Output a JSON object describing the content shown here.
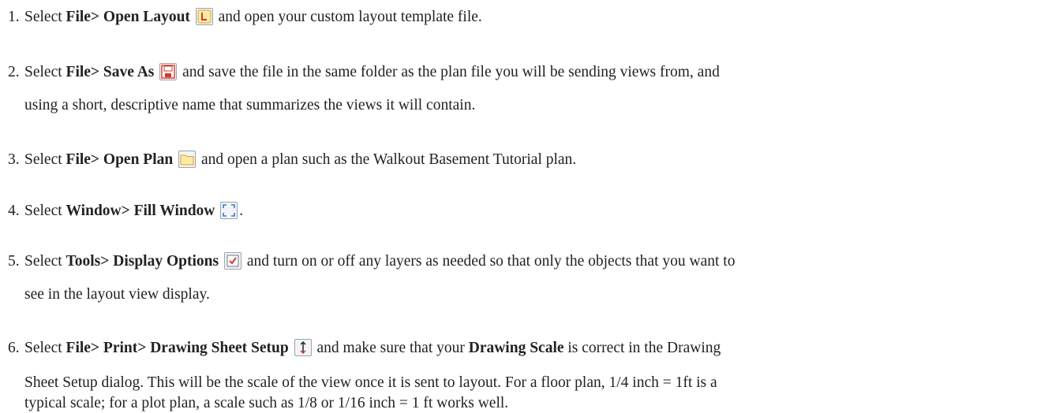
{
  "steps": [
    {
      "number": "1.",
      "lines": [
        [
          {
            "t": "Select "
          },
          {
            "t": "File> Open Layout",
            "b": true
          },
          {
            "t": " "
          },
          {
            "icon": "open-layout-icon"
          },
          {
            "t": " and open your custom layout template file."
          }
        ]
      ]
    },
    {
      "number": "2.",
      "lines": [
        [
          {
            "t": "Select "
          },
          {
            "t": "File> Save As",
            "b": true
          },
          {
            "t": " "
          },
          {
            "icon": "save-as-icon"
          },
          {
            "t": " and save the file in the same folder as the plan file you will be sending views from, and"
          }
        ],
        [
          {
            "t": "using a short, descriptive name that summarizes the views it will contain."
          }
        ]
      ]
    },
    {
      "number": "3.",
      "lines": [
        [
          {
            "t": "Select "
          },
          {
            "t": "File> Open Plan",
            "b": true
          },
          {
            "t": " "
          },
          {
            "icon": "open-plan-icon"
          },
          {
            "t": " and open a plan such as the Walkout Basement Tutorial plan."
          }
        ]
      ]
    },
    {
      "number": "4.",
      "lines": [
        [
          {
            "t": "Select "
          },
          {
            "t": "Window> Fill Window",
            "b": true
          },
          {
            "t": " "
          },
          {
            "icon": "fill-window-icon"
          },
          {
            "t": "."
          }
        ]
      ]
    },
    {
      "number": "5.",
      "lines": [
        [
          {
            "t": "Select "
          },
          {
            "t": "Tools> Display Options",
            "b": true
          },
          {
            "t": " "
          },
          {
            "icon": "display-options-icon"
          },
          {
            "t": " and turn on or off any layers as needed so that only the objects that you want to"
          }
        ],
        [
          {
            "t": "see in the layout view display."
          }
        ]
      ]
    },
    {
      "number": "6.",
      "lines": [
        [
          {
            "t": "Select "
          },
          {
            "t": "File> Print> Drawing Sheet Setup",
            "b": true
          },
          {
            "t": " "
          },
          {
            "icon": "drawing-sheet-setup-icon"
          },
          {
            "t": " and make sure that your "
          },
          {
            "t": "Drawing Scale",
            "b": true
          },
          {
            "t": " is correct in the Drawing"
          }
        ],
        [
          {
            "t": "Sheet Setup dialog. This will be the scale of the view once it is sent to layout. For a floor plan, 1/4 inch = 1ft is a"
          }
        ],
        [
          {
            "t": "typical scale; for a plot plan, a scale such as 1/8 or 1/16 inch = 1 ft works well."
          }
        ]
      ]
    }
  ]
}
